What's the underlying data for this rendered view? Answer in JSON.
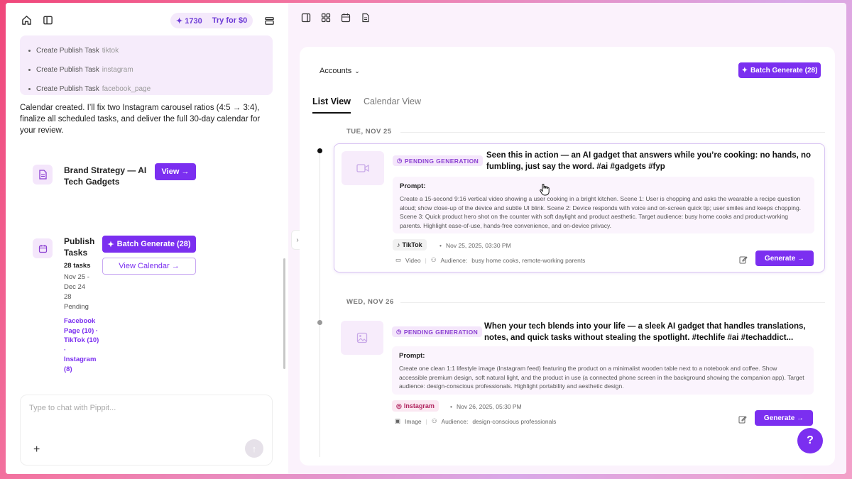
{
  "header": {
    "credits": "✦ 1730",
    "try_label": "Try for $0"
  },
  "subtasks": [
    {
      "label": "Create Publish Task",
      "platform": "tiktok"
    },
    {
      "label": "Create Publish Task",
      "platform": "instagram"
    },
    {
      "label": "Create Publish Task",
      "platform": "facebook_page"
    }
  ],
  "chat_message": "Calendar created. I’ll fix two Instagram carousel ratios (4:5 → 3:4), finalize all scheduled tasks, and deliver the full 30-day calendar for your review.",
  "brand_card": {
    "title": "Brand Strategy — AI Tech Gadgets",
    "view_label": "View →"
  },
  "publish_card": {
    "title": "Publish Tasks",
    "count": "28 tasks",
    "range": "Nov 25 - Dec 24",
    "pending_count": "28",
    "pending_label": "Pending",
    "breakdown": "Facebook Page (10) · TikTok (10) · Instagram (8)",
    "batch_label": "Batch Generate (28)",
    "calendar_label": "View Calendar →"
  },
  "chat_input": {
    "placeholder": "Type to chat with Pippit..."
  },
  "main": {
    "accounts_label": "Accounts",
    "batch_label": "Batch Generate (28)",
    "tabs": [
      {
        "label": "List View",
        "active": true
      },
      {
        "label": "Calendar View",
        "active": false
      }
    ]
  },
  "days": [
    {
      "date": "TUE, NOV 25",
      "post": {
        "status": "PENDING GENERATION",
        "caption": "Seen this in action — an AI gadget that answers while you’re cooking: no hands, no fumbling, just say the word. #ai #gadgets #fyp",
        "prompt_label": "Prompt:",
        "prompt": "Create a 15-second 9:16 vertical video showing a user cooking in a bright kitchen. Scene 1: User is chopping and asks the wearable a recipe question aloud; show close-up of the device and subtle UI blink. Scene 2: Device responds with voice and on-screen quick tip; user smiles and keeps chopping. Scene 3: Quick product hero shot on the counter with soft daylight and product aesthetic. Target audience: busy home cooks and product-working parents. Highlight ease-of-use, hands-free convenience, and on-device privacy.",
        "platform": "TikTok",
        "schedule": "Nov 25, 2025, 03:30 PM",
        "media": "Video",
        "audience_label": "Audience:",
        "audience": "busy home cooks, remote-working parents",
        "generate_label": "Generate →"
      }
    },
    {
      "date": "WED, NOV 26",
      "post": {
        "status": "PENDING GENERATION",
        "caption": "When your tech blends into your life — a sleek AI gadget that handles translations, notes, and quick tasks without stealing the spotlight. #techlife #ai #techaddict...",
        "prompt_label": "Prompt:",
        "prompt": "Create one clean 1:1 lifestyle image (Instagram feed) featuring the product on a minimalist wooden table next to a notebook and coffee. Show accessible premium design, soft natural light, and the product in use (a connected phone screen in the background showing the companion app). Target audience: design-conscious professionals. Highlight portability and aesthetic design.",
        "platform": "Instagram",
        "schedule": "Nov 26, 2025, 05:30 PM",
        "media": "Image",
        "audience_label": "Audience:",
        "audience": "design-conscious professionals",
        "generate_label": "Generate →"
      }
    }
  ],
  "colors": {
    "accent": "#7b2ff0",
    "pending_bg": "#f4e6fb",
    "tiktok_bg": "#f1f1f1",
    "instagram_bg": "#fbe8f2"
  }
}
